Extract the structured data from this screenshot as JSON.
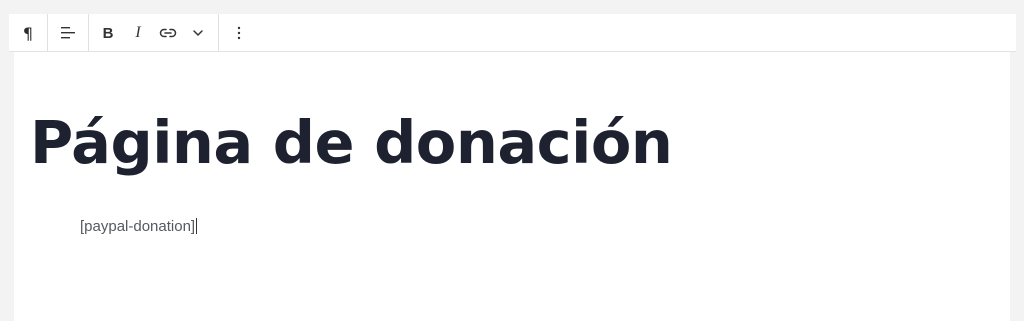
{
  "toolbar": {
    "paragraph_icon": "pilcrow-icon",
    "align_icon": "align-left-icon",
    "bold_label": "B",
    "italic_label": "I",
    "link_icon": "link-icon",
    "more_formatting_icon": "chevron-down-icon",
    "options_icon": "vertical-ellipsis-icon"
  },
  "editor": {
    "title": "Página de donación",
    "shortcode": "[paypal-donation]"
  },
  "colors": {
    "background": "#f3f3f3",
    "canvas": "#ffffff",
    "title_text": "#1d2130",
    "body_text": "#555a60"
  }
}
